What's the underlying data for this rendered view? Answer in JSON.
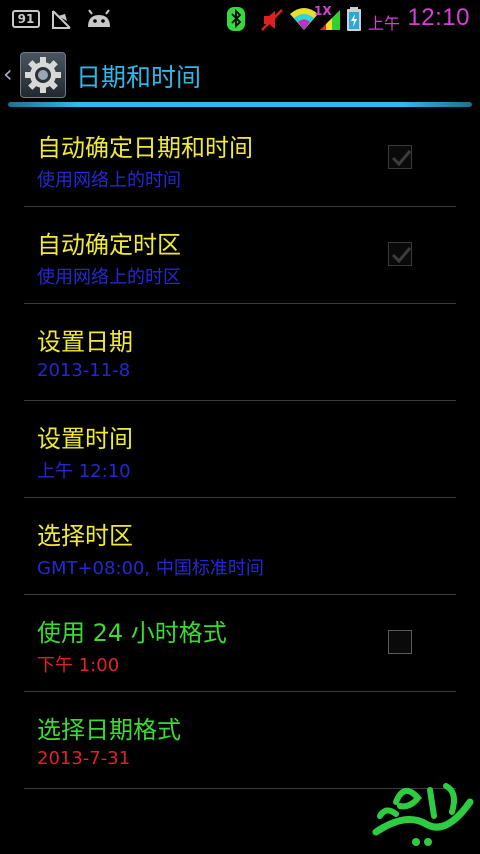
{
  "status_bar": {
    "badge_text": "91",
    "ampm": "上午",
    "time": "12:10",
    "network_label": "1X",
    "icons": [
      "notification-badge-icon",
      "usb-debug-icon",
      "android-icon",
      "bluetooth-icon",
      "mute-icon",
      "wifi-icon",
      "signal-icon",
      "battery-charging-icon"
    ]
  },
  "action_bar": {
    "title": "日期和时间",
    "accent_color": "#33b5e5"
  },
  "settings": [
    {
      "title": "自动确定日期和时间",
      "summary": "使用网络上的时间",
      "has_checkbox": true,
      "checked": true,
      "enabled": false
    },
    {
      "title": "自动确定时区",
      "summary": "使用网络上的时区",
      "has_checkbox": true,
      "checked": true,
      "enabled": false
    },
    {
      "title": "设置日期",
      "summary": "2013-11-8",
      "has_checkbox": false
    },
    {
      "title": "设置时间",
      "summary": "上午 12:10",
      "has_checkbox": false
    },
    {
      "title": "选择时区",
      "summary": "GMT+08:00, 中国标准时间",
      "has_checkbox": false
    },
    {
      "title": "使用 24 小时格式",
      "summary": "下午 1:00",
      "has_checkbox": true,
      "checked": false,
      "enabled": true
    },
    {
      "title": "选择日期格式",
      "summary": "2013-7-31",
      "has_checkbox": false
    }
  ],
  "colors": {
    "title_yellow": "#f0ea37",
    "title_green": "#3cdb33",
    "summary_blue": "#2528d2",
    "summary_red": "#e0202a",
    "status_time": "#d63fd6"
  }
}
